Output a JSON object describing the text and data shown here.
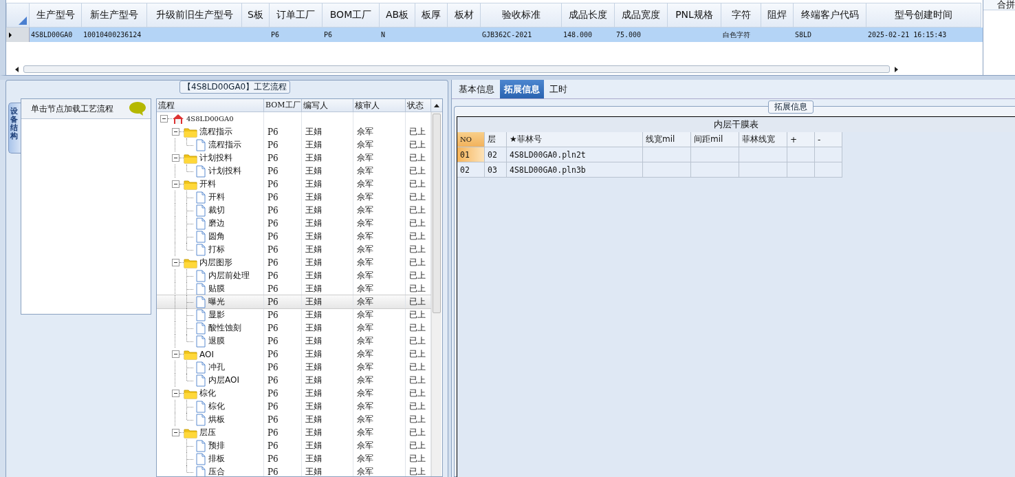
{
  "model_grid": {
    "columns": [
      "生产型号",
      "新生产型号",
      "升级前旧生产型号",
      "S板",
      "订单工厂",
      "BOM工厂",
      "AB板",
      "板厚",
      "板材",
      "验收标准",
      "成品长度",
      "成品宽度",
      "PNL规格",
      "字符",
      "阻焊",
      "终端客户代码",
      "型号创建时间"
    ],
    "rows": [
      {
        "selected": true,
        "cells": [
          "4S8LD00GA0",
          "10010400236124",
          null,
          null,
          "P6",
          "P6",
          "N",
          null,
          null,
          "GJB362C-2021",
          "148.000",
          "75.000",
          null,
          "白色字符",
          null,
          "S8LD",
          "2025-02-21 16:15:43"
        ]
      }
    ]
  },
  "side_header": "合拼",
  "process_panel": {
    "title": "【4S8LD00GA0】工艺流程",
    "side_tab": "设备结构",
    "node_hint": "单击节点加载工艺流程",
    "tree": {
      "columns": [
        "流程",
        "BOM工厂",
        "编写人",
        "核审人",
        "状态"
      ],
      "nodes": [
        {
          "kind": "root",
          "label": "4S8LD00GA0",
          "expanded": true,
          "selected": false,
          "children": [
            {
              "kind": "folder",
              "label": "流程指示",
              "bom": "P6",
              "writer": "王娟",
              "reviewer": "佘军",
              "status": "已上",
              "expanded": true,
              "selected": false,
              "children": [
                {
                  "kind": "step",
                  "label": "流程指示",
                  "bom": "P6",
                  "writer": "王娟",
                  "reviewer": "佘军",
                  "status": "已上",
                  "selected": false
                }
              ]
            },
            {
              "kind": "folder",
              "label": "计划投料",
              "bom": "P6",
              "writer": "王娟",
              "reviewer": "佘军",
              "status": "已上",
              "expanded": true,
              "selected": false,
              "children": [
                {
                  "kind": "step",
                  "label": "计划投料",
                  "bom": "P6",
                  "writer": "王娟",
                  "reviewer": "佘军",
                  "status": "已上",
                  "selected": false
                }
              ]
            },
            {
              "kind": "folder",
              "label": "开料",
              "bom": "P6",
              "writer": "王娟",
              "reviewer": "佘军",
              "status": "已上",
              "expanded": true,
              "selected": false,
              "children": [
                {
                  "kind": "step",
                  "label": "开料",
                  "bom": "P6",
                  "writer": "王娟",
                  "reviewer": "佘军",
                  "status": "已上",
                  "selected": false
                },
                {
                  "kind": "step",
                  "label": "裁切",
                  "bom": "P6",
                  "writer": "王娟",
                  "reviewer": "佘军",
                  "status": "已上",
                  "selected": false
                },
                {
                  "kind": "step",
                  "label": "磨边",
                  "bom": "P6",
                  "writer": "王娟",
                  "reviewer": "佘军",
                  "status": "已上",
                  "selected": false
                },
                {
                  "kind": "step",
                  "label": "圆角",
                  "bom": "P6",
                  "writer": "王娟",
                  "reviewer": "佘军",
                  "status": "已上",
                  "selected": false
                },
                {
                  "kind": "step",
                  "label": "打标",
                  "bom": "P6",
                  "writer": "王娟",
                  "reviewer": "佘军",
                  "status": "已上",
                  "selected": false
                }
              ]
            },
            {
              "kind": "folder",
              "label": "内层图形",
              "bom": "P6",
              "writer": "王娟",
              "reviewer": "佘军",
              "status": "已上",
              "expanded": true,
              "selected": false,
              "children": [
                {
                  "kind": "step",
                  "label": "内层前处理",
                  "bom": "P6",
                  "writer": "王娟",
                  "reviewer": "佘军",
                  "status": "已上",
                  "selected": false
                },
                {
                  "kind": "step",
                  "label": "贴膜",
                  "bom": "P6",
                  "writer": "王娟",
                  "reviewer": "佘军",
                  "status": "已上",
                  "selected": false
                },
                {
                  "kind": "step",
                  "label": "曝光",
                  "bom": "P6",
                  "writer": "王娟",
                  "reviewer": "佘军",
                  "status": "已上",
                  "selected": true
                },
                {
                  "kind": "step",
                  "label": "显影",
                  "bom": "P6",
                  "writer": "王娟",
                  "reviewer": "佘军",
                  "status": "已上",
                  "selected": false
                },
                {
                  "kind": "step",
                  "label": "酸性蚀刻",
                  "bom": "P6",
                  "writer": "王娟",
                  "reviewer": "佘军",
                  "status": "已上",
                  "selected": false
                },
                {
                  "kind": "step",
                  "label": "退膜",
                  "bom": "P6",
                  "writer": "王娟",
                  "reviewer": "佘军",
                  "status": "已上",
                  "selected": false
                }
              ]
            },
            {
              "kind": "folder",
              "label": "AOI",
              "bom": "P6",
              "writer": "王娟",
              "reviewer": "佘军",
              "status": "已上",
              "expanded": true,
              "selected": false,
              "children": [
                {
                  "kind": "step",
                  "label": "冲孔",
                  "bom": "P6",
                  "writer": "王娟",
                  "reviewer": "佘军",
                  "status": "已上",
                  "selected": false
                },
                {
                  "kind": "step",
                  "label": "内层AOI",
                  "bom": "P6",
                  "writer": "王娟",
                  "reviewer": "佘军",
                  "status": "已上",
                  "selected": false
                }
              ]
            },
            {
              "kind": "folder",
              "label": "棕化",
              "bom": "P6",
              "writer": "王娟",
              "reviewer": "佘军",
              "status": "已上",
              "expanded": true,
              "selected": false,
              "children": [
                {
                  "kind": "step",
                  "label": "棕化",
                  "bom": "P6",
                  "writer": "王娟",
                  "reviewer": "佘军",
                  "status": "已上",
                  "selected": false
                },
                {
                  "kind": "step",
                  "label": "烘板",
                  "bom": "P6",
                  "writer": "王娟",
                  "reviewer": "佘军",
                  "status": "已上",
                  "selected": false
                }
              ]
            },
            {
              "kind": "folder",
              "label": "层压",
              "bom": "P6",
              "writer": "王娟",
              "reviewer": "佘军",
              "status": "已上",
              "expanded": true,
              "selected": false,
              "children": [
                {
                  "kind": "step",
                  "label": "预排",
                  "bom": "P6",
                  "writer": "王娟",
                  "reviewer": "佘军",
                  "status": "已上",
                  "selected": false
                },
                {
                  "kind": "step",
                  "label": "排板",
                  "bom": "P6",
                  "writer": "王娟",
                  "reviewer": "佘军",
                  "status": "已上",
                  "selected": false
                },
                {
                  "kind": "step",
                  "label": "压合",
                  "bom": "P6",
                  "writer": "王娟",
                  "reviewer": "佘军",
                  "status": "已上",
                  "selected": false
                }
              ]
            }
          ]
        }
      ]
    }
  },
  "detail_panel": {
    "tabs": [
      {
        "label": "基本信息",
        "selected": false
      },
      {
        "label": "拓展信息",
        "selected": true
      },
      {
        "label": "工时",
        "selected": false
      }
    ],
    "group_title": "拓展信息",
    "table": {
      "title": "内层干膜表",
      "columns": [
        "NO",
        "层",
        "★菲林号",
        "线宽mil",
        "间距mil",
        "菲林线宽",
        "+",
        "-"
      ],
      "rows": [
        {
          "selected": true,
          "cells": [
            "01",
            "02",
            "4S8LD00GA0.pln2t"
          ]
        },
        {
          "selected": false,
          "cells": [
            "02",
            "03",
            "4S8LD00GA0.pln3b"
          ]
        }
      ]
    }
  }
}
